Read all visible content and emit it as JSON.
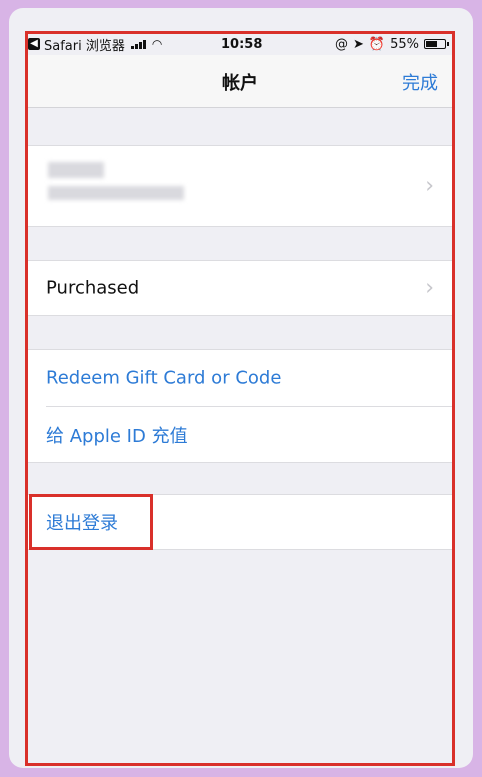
{
  "status_bar": {
    "app": "Safari 浏览器",
    "time": "10:58",
    "battery": "55%",
    "back_icon": "back-arrow-icon",
    "right_icons": [
      "location-lock-icon",
      "location-arrow-icon",
      "alarm-icon"
    ]
  },
  "nav": {
    "title": "帐户",
    "done_label": "完成"
  },
  "account_row": {
    "name": "",
    "email": ""
  },
  "rows": {
    "purchased": "Purchased",
    "redeem": "Redeem Gift Card or Code",
    "add_funds": "给 Apple ID 充值",
    "sign_out": "退出登录"
  },
  "colors": {
    "accent": "#2d7bd6",
    "highlight": "#d9302a",
    "background_frame": "#d8b4e6"
  }
}
